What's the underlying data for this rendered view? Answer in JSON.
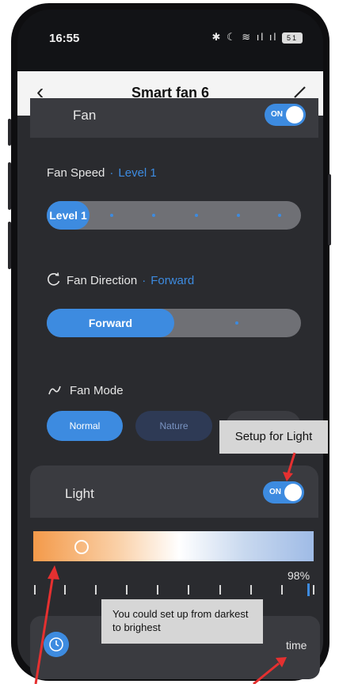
{
  "status_bar": {
    "time": "16:55",
    "icons": "✱ ☾ ≋ ıl ıl",
    "battery": "51"
  },
  "header": {
    "title": "Smart fan 6"
  },
  "fan": {
    "label": "Fan",
    "toggle": "ON",
    "speed_label": "Fan Speed",
    "speed_value": "Level 1",
    "speed_pill": "Level 1",
    "direction_label": "Fan Direction",
    "direction_value": "Forward",
    "direction_pill": "Forward",
    "mode_label": "Fan Mode",
    "modes": [
      "Normal",
      "Nature"
    ]
  },
  "light": {
    "label": "Light",
    "toggle": "ON",
    "brightness": "98%"
  },
  "bottom": {
    "time_label": "time"
  },
  "callouts": {
    "setup": "Setup for Light",
    "range": "You could set up from darkest to brighest"
  },
  "colors": {
    "accent": "#3d8be0",
    "panel": "#2a2b2f",
    "card": "#3a3b40"
  }
}
